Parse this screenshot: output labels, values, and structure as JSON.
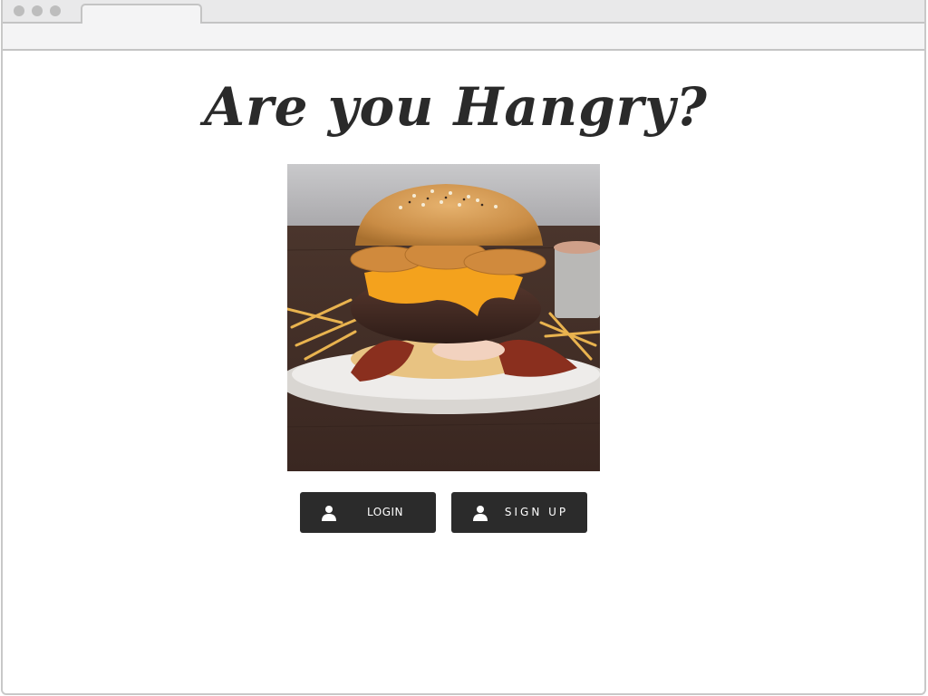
{
  "hero": {
    "headline": "Are you Hangry?",
    "image_description": "burger-photo"
  },
  "actions": {
    "login_label": "LOGIN",
    "signup_label": "SIGN UP",
    "login_icon": "user-icon",
    "signup_icon": "user-icon"
  },
  "colors": {
    "button_bg": "#2b2b2b",
    "button_text": "#ffffff",
    "headline": "#2a2a2a"
  }
}
